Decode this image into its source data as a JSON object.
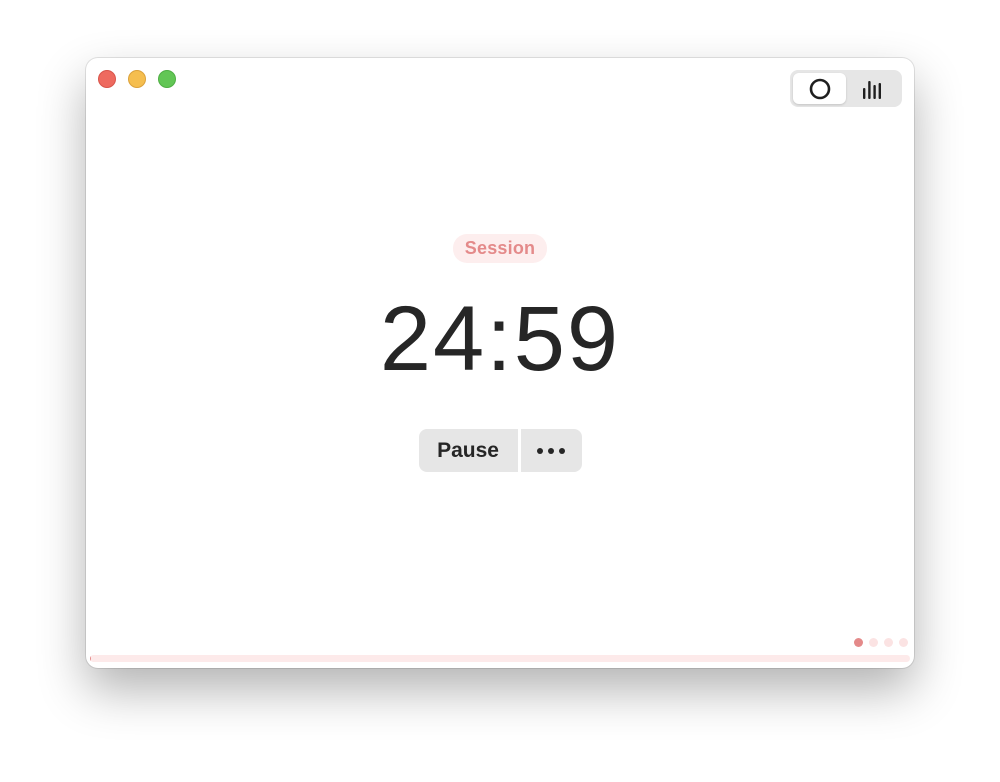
{
  "window": {
    "traffic_lights": [
      "close",
      "minimize",
      "zoom"
    ]
  },
  "view_switcher": {
    "options": [
      {
        "icon": "circle-timer-icon",
        "active": true
      },
      {
        "icon": "bar-chart-icon",
        "active": false
      }
    ]
  },
  "session": {
    "label": "Session",
    "time": "24:59"
  },
  "controls": {
    "pause_label": "Pause",
    "more_icon": "ellipsis-icon"
  },
  "pager": {
    "count": 4,
    "active_index": 0
  },
  "progress": {
    "fraction": 0.0007
  },
  "colors": {
    "accent": "#e48a8a",
    "accent_light": "#fdeeee",
    "close": "#ee6a5f",
    "minimize": "#f5be4f",
    "zoom": "#62c655"
  }
}
